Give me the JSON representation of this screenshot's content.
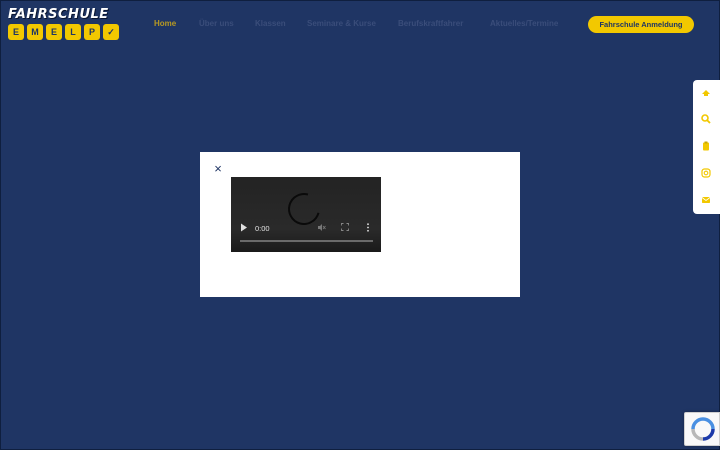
{
  "brand": {
    "name": "FAHRSCHULE",
    "chips": [
      "E",
      "M",
      "E",
      "L",
      "P",
      "✓"
    ]
  },
  "nav": {
    "items": [
      {
        "label": "Home",
        "active": true
      },
      {
        "label": "Über uns",
        "active": false
      },
      {
        "label": "Klassen",
        "active": false
      },
      {
        "label": "Seminare & Kurse",
        "active": false
      },
      {
        "label": "Berufskraftfahrer",
        "active": false
      },
      {
        "label": "Aktuelles/Termine",
        "active": false
      }
    ],
    "cta_label": "Fahrschule Anmeldung"
  },
  "side_tools": [
    "cap-icon",
    "search-icon",
    "clipboard-icon",
    "instagram-icon",
    "mail-icon"
  ],
  "modal": {
    "close_glyph": "×",
    "video": {
      "time": "0:00"
    }
  },
  "colors": {
    "background": "#1f3564",
    "accent": "#f2c800",
    "modal": "#ffffff"
  }
}
